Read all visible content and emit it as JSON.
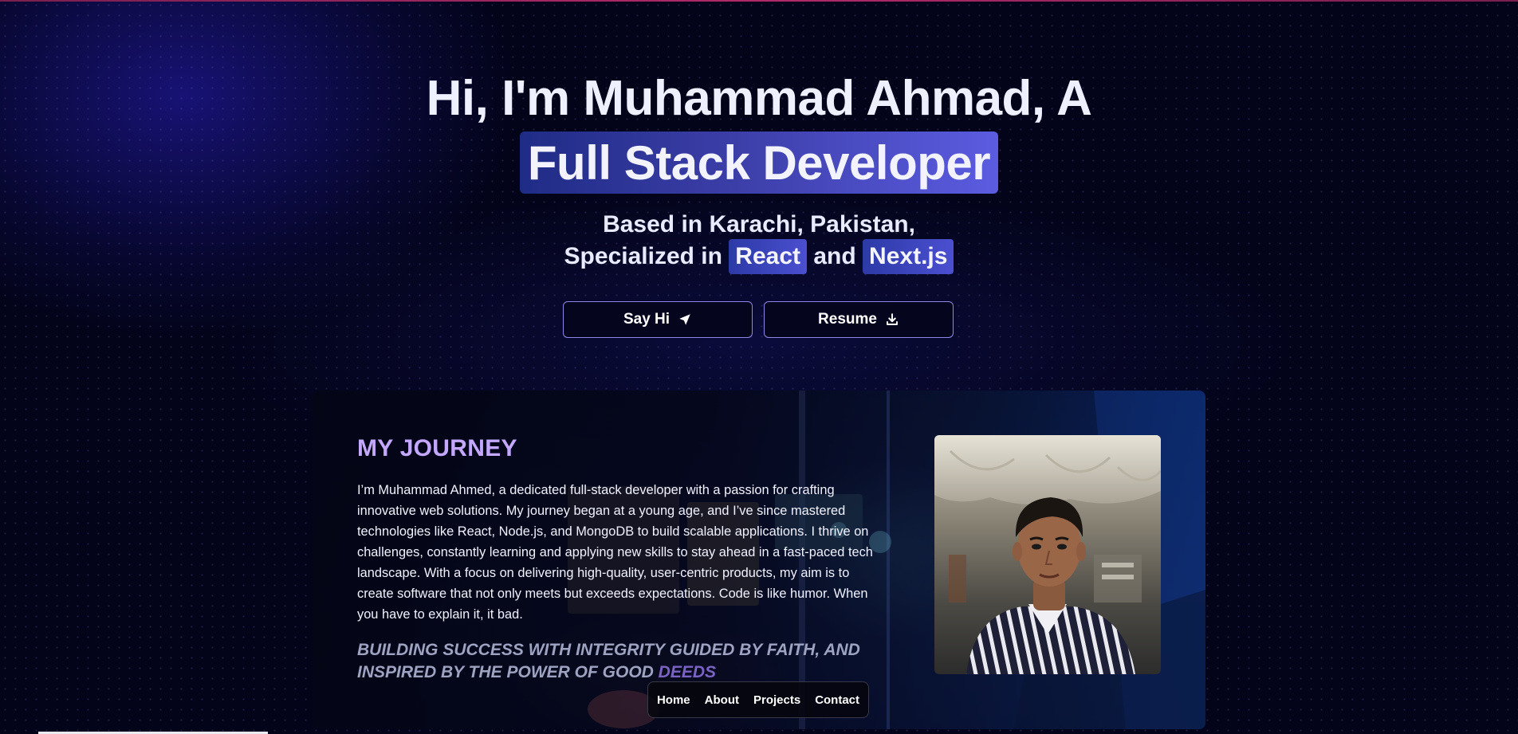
{
  "hero": {
    "headline_line1": "Hi, I'm Muhammad Ahmad, A",
    "headline_highlight": "Full Stack Developer",
    "subtitle_line1": "Based in Karachi, Pakistan,",
    "subtitle_prefix": "Specialized in",
    "tech_1": "React",
    "subtitle_joiner": "and",
    "tech_2": "Next.js",
    "buttons": {
      "say_hi_label": "Say Hi",
      "say_hi_icon": "paper-plane-icon",
      "resume_label": "Resume",
      "resume_icon": "download-icon"
    }
  },
  "journey": {
    "title": "MY JOURNEY",
    "body": "I’m Muhammad Ahmed, a dedicated full-stack developer with a passion for crafting innovative web solutions. My journey began at a young age, and I’ve since mastered technologies like React, Node.js, and MongoDB to build scalable applications. I thrive on challenges, constantly learning and applying new skills to stay ahead in a fast-paced tech landscape. With a focus on delivering high-quality, user-centric products, my aim is to create software that not only meets but exceeds expectations. Code is like humor. When you have to explain it, it bad.",
    "motto_main": "BUILDING SUCCESS WITH INTEGRITY GUIDED BY FAITH, AND INSPIRED BY THE POWER OF GOOD",
    "motto_accent": "DEEDS"
  },
  "nav": {
    "items": [
      {
        "label": "Home"
      },
      {
        "label": "About"
      },
      {
        "label": "Projects"
      },
      {
        "label": "Contact"
      }
    ]
  },
  "colors": {
    "background": "#03041a",
    "accent_purple": "#c4a8ff",
    "highlight_gradient_start": "#1f2c86",
    "highlight_gradient_end": "#5b5ce0",
    "button_border": "#8f86e8",
    "top_line": "#b02a6a"
  }
}
